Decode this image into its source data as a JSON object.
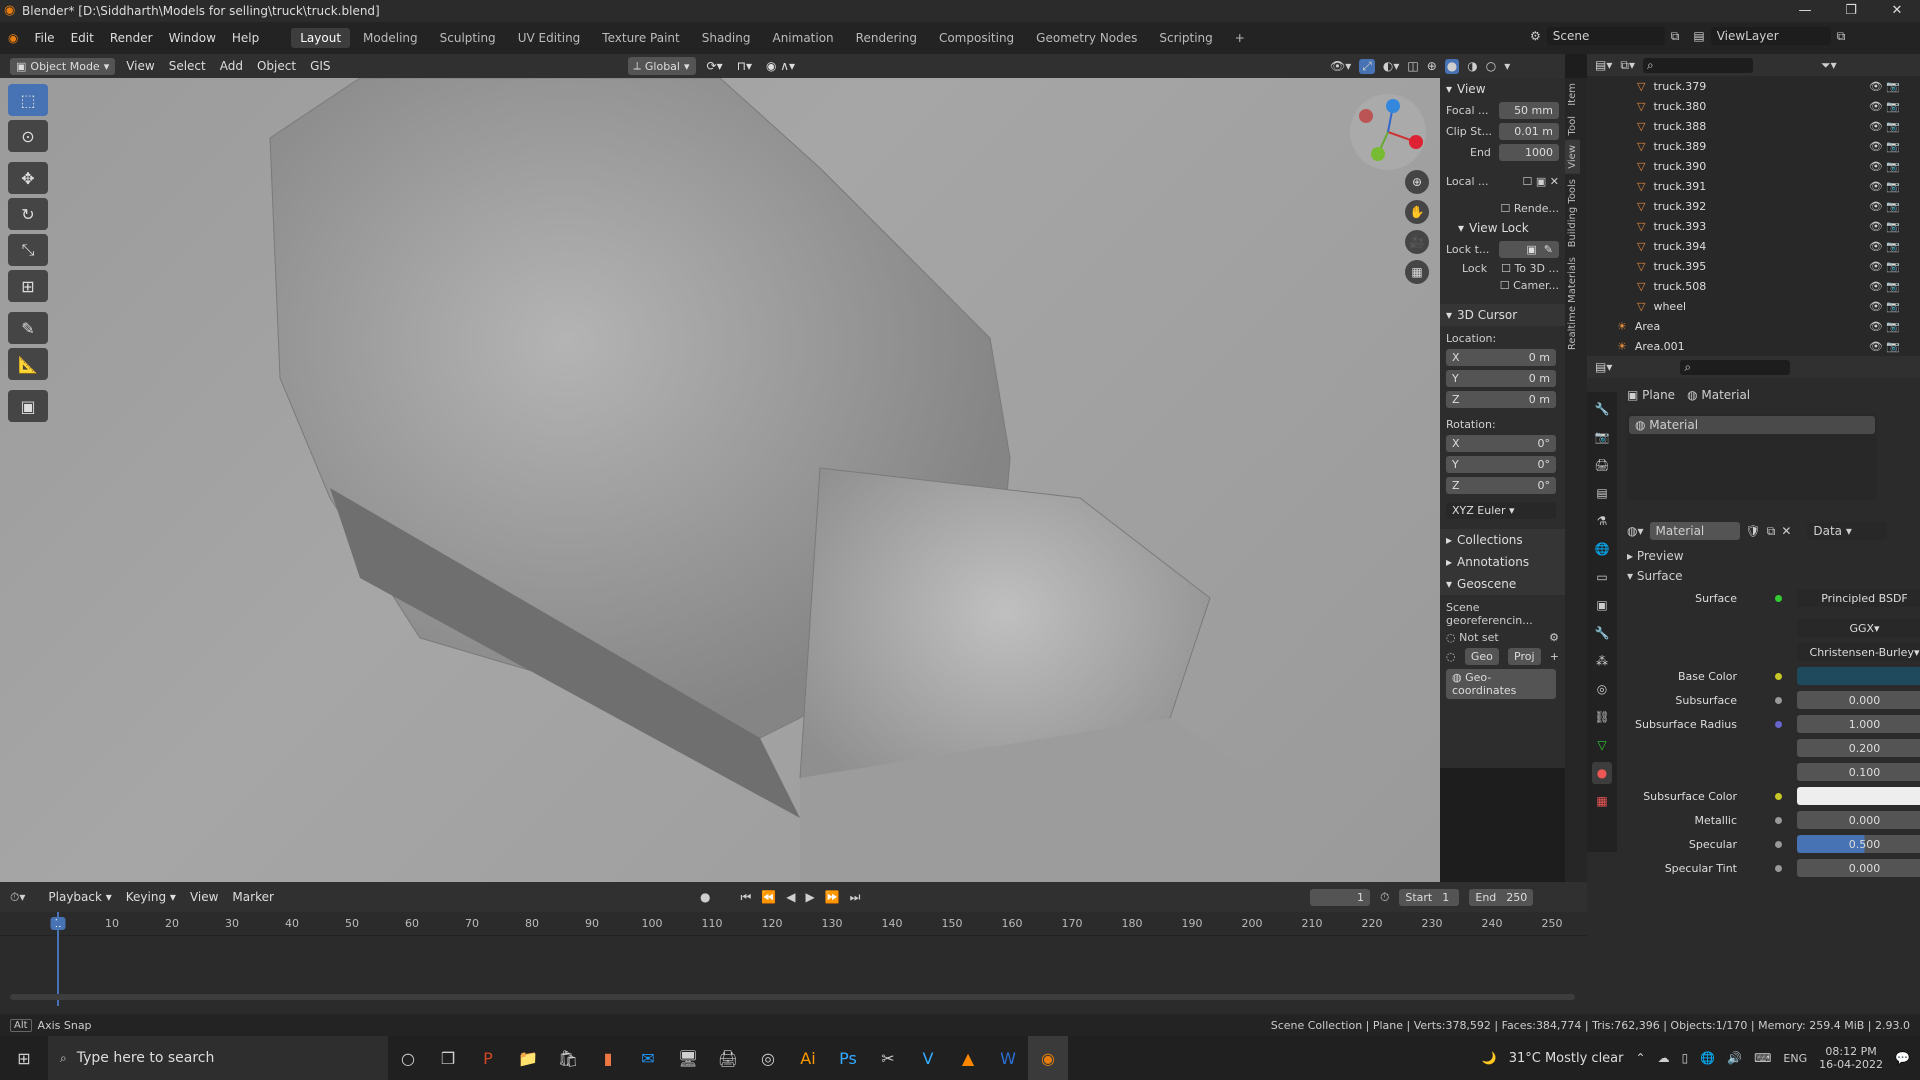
{
  "window": {
    "title": "Blender* [D:\\Siddharth\\Models for selling\\truck\\truck.blend]"
  },
  "menus": [
    "File",
    "Edit",
    "Render",
    "Window",
    "Help"
  ],
  "workspaces": [
    "Layout",
    "Modeling",
    "Sculpting",
    "UV Editing",
    "Texture Paint",
    "Shading",
    "Animation",
    "Rendering",
    "Compositing",
    "Geometry Nodes",
    "Scripting"
  ],
  "active_workspace": "Layout",
  "scene": {
    "name": "Scene",
    "view_layer": "ViewLayer"
  },
  "header3d": {
    "mode": "Object Mode",
    "items": [
      "View",
      "Select",
      "Add",
      "Object",
      "GIS"
    ],
    "transform": "Global"
  },
  "npanel": {
    "view_title": "View",
    "focal_label": "Focal ...",
    "focal": "50 mm",
    "clip_label": "Clip St...",
    "clip": "0.01 m",
    "end_label": "End",
    "end": "1000",
    "local_label": "Local ...",
    "render_label": "Rende...",
    "view_lock_title": "View Lock",
    "lock_to_label": "Lock t...",
    "lock_label": "Lock",
    "to3d_label": "To 3D ...",
    "camera_label": "Camer...",
    "cursor_title": "3D Cursor",
    "location_label": "Location:",
    "loc_x": "0 m",
    "loc_y": "0 m",
    "loc_z": "0 m",
    "rotation_label": "Rotation:",
    "rot_x": "0°",
    "rot_y": "0°",
    "rot_z": "0°",
    "rotation_mode": "XYZ Euler",
    "collections": "Collections",
    "annotations": "Annotations",
    "geoscene": "Geoscene",
    "georef_label": "Scene georeferencin...",
    "not_set": "Not set",
    "geo_btn": "Geo",
    "proj_btn": "Proj",
    "geocoords": "Geo-coordinates"
  },
  "side_tabs": [
    "Item",
    "Tool",
    "View",
    "Building Tools",
    "Realtime Materials"
  ],
  "outliner": {
    "items": [
      "truck.379",
      "truck.380",
      "truck.388",
      "truck.389",
      "truck.390",
      "truck.391",
      "truck.392",
      "truck.393",
      "truck.394",
      "truck.395",
      "truck.508",
      "wheel"
    ],
    "lights": [
      "Area",
      "Area.001"
    ]
  },
  "properties": {
    "breadcrumb_object": "Plane",
    "breadcrumb_material": "Material",
    "slot": "Material",
    "material_name": "Material",
    "data_label": "Data",
    "preview": "Preview",
    "surface_section": "Surface",
    "surface_label": "Surface",
    "surface_shader": "Principled BSDF",
    "distribution": "GGX",
    "subsurface_method": "Christensen-Burley",
    "rows": [
      {
        "label": "Base Color",
        "value": ""
      },
      {
        "label": "Subsurface",
        "value": "0.000"
      },
      {
        "label": "Subsurface Radius",
        "value": "1.000"
      },
      {
        "label": "",
        "value": "0.200"
      },
      {
        "label": "",
        "value": "0.100"
      },
      {
        "label": "Subsurface Color",
        "value": ""
      },
      {
        "label": "Metallic",
        "value": "0.000"
      },
      {
        "label": "Specular",
        "value": "0.500"
      },
      {
        "label": "Specular Tint",
        "value": "0.000"
      }
    ],
    "base_color_hex": "#1f4a5e"
  },
  "timeline": {
    "menus": [
      "Playback",
      "Keying",
      "View",
      "Marker"
    ],
    "current_frame": "1",
    "start_label": "Start",
    "start": "1",
    "end_label": "End",
    "end": "250",
    "ticks": [
      "1",
      "10",
      "20",
      "30",
      "40",
      "50",
      "60",
      "70",
      "80",
      "90",
      "100",
      "110",
      "120",
      "130",
      "140",
      "150",
      "160",
      "170",
      "180",
      "190",
      "200",
      "210",
      "220",
      "230",
      "240",
      "250"
    ]
  },
  "status": {
    "left": "Axis Snap",
    "right": "Scene Collection | Plane | Verts:378,592 | Faces:384,774 | Tris:762,396 | Objects:1/170 | Memory: 259.4 MiB | 2.93.0"
  },
  "taskbar": {
    "search_placeholder": "Type here to search",
    "weather": "31°C  Mostly clear",
    "lang": "ENG",
    "time": "08:12 PM",
    "date": "16-04-2022"
  }
}
